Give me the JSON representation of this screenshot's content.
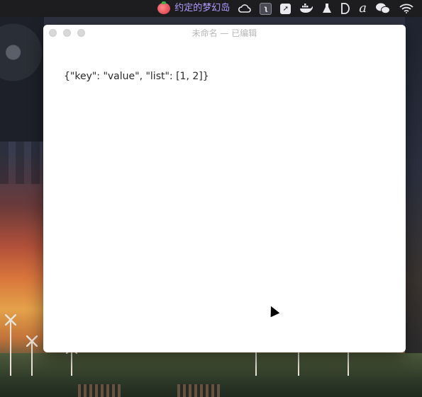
{
  "menubar": {
    "items": [
      {
        "icon": "tomato-icon"
      },
      {
        "label": "约定的梦幻岛"
      },
      {
        "icon": "cloud-icon"
      },
      {
        "icon": "app-box-icon"
      },
      {
        "icon": "paper-plane-icon"
      },
      {
        "icon": "docker-whale-icon"
      },
      {
        "icon": "flask-icon"
      },
      {
        "icon": "d-logo-icon"
      },
      {
        "icon": "script-a-icon"
      },
      {
        "icon": "wechat-icon"
      },
      {
        "icon": "wifi-icon"
      }
    ],
    "task_color": "#b19bff"
  },
  "window": {
    "title": "未命名 — 已编辑",
    "content": "{\"key\": \"value\", \"list\": [1, 2]}"
  }
}
